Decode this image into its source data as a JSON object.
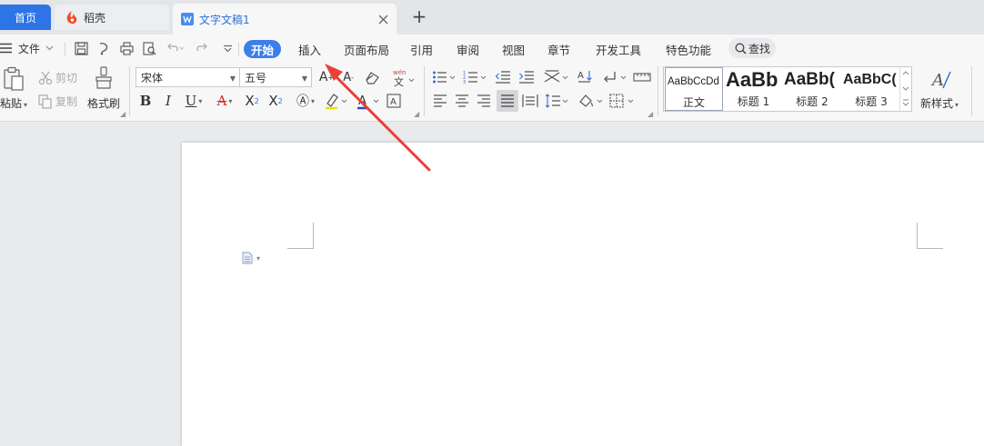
{
  "tabs": {
    "home": "首页",
    "daoke": "稻壳",
    "doc": "文字文稿1",
    "add": "+"
  },
  "menu": {
    "file": "文件",
    "tabs": [
      "开始",
      "插入",
      "页面布局",
      "引用",
      "审阅",
      "视图",
      "章节",
      "开发工具",
      "特色功能"
    ],
    "active_tab": "开始",
    "search": "查找"
  },
  "clipboard": {
    "paste": "粘贴",
    "cut": "剪切",
    "copy": "复制",
    "format_painter": "格式刷"
  },
  "font": {
    "name": "宋体",
    "size": "五号"
  },
  "styles": {
    "items": [
      {
        "sample": "AaBbCcDd",
        "name": "正文"
      },
      {
        "sample": "AaBb",
        "name": "标题 1"
      },
      {
        "sample": "AaBb(",
        "name": "标题 2"
      },
      {
        "sample": "AaBbC(",
        "name": "标题 3"
      }
    ],
    "new_style": "新样式"
  },
  "colors": {
    "accent": "#3d7fe8",
    "tab_blue": "#2d74e6",
    "arrow": "#e8403a",
    "daoke_icon": "#f04a22"
  }
}
